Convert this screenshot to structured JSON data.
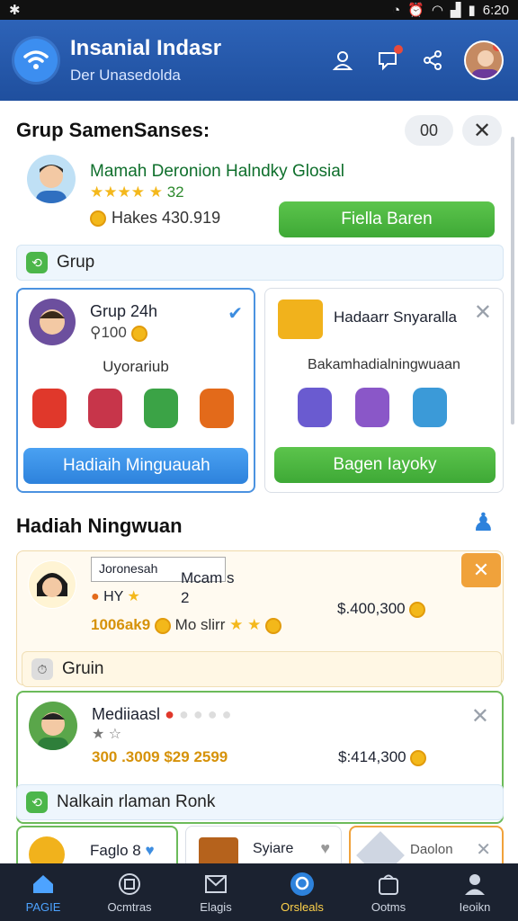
{
  "status": {
    "time": "6:20"
  },
  "appbar": {
    "title": "Insanial Indasr",
    "subtitle": "Der Unasedolda"
  },
  "section1": {
    "title": "Grup SamenSanses:",
    "pill_value": "00",
    "profile": {
      "name": "Mamah Deronion Halndky Glosial",
      "rating": "32",
      "coins_label": "Hakes 430.919",
      "button": "Fiella Baren"
    }
  },
  "grup_strip": {
    "label": "Grup"
  },
  "card_left": {
    "title": "Grup 24h",
    "points": "100",
    "subtitle": "Uyorariub",
    "icons": [
      "Alsate",
      "Ploine",
      "Sendin",
      "Jarraelu"
    ],
    "button": "Hadiaih Minguauah"
  },
  "card_right": {
    "title": "Hadaarr Snyaralla",
    "subtitle": "Bakamhadialningwuaan",
    "icons": [
      "Rousle",
      "Serofe",
      "Alesd"
    ],
    "button": "Bagen Iayoky"
  },
  "section2": {
    "title": "Hadiah Ningwuan"
  },
  "entry1": {
    "tag": "Joronesah",
    "name": "Mcam s",
    "num": "2",
    "sub": "HY",
    "amount_left": "1006ak9",
    "amount_left2": "Mo slirr",
    "amount_right": "$.400,300"
  },
  "strip2": {
    "label": "Gruin"
  },
  "entry2": {
    "name": "Mediiaasl",
    "amount_left": "300 .3009 $29 2599",
    "amount_right": "$:414,300"
  },
  "strip3": {
    "label": "Nalkain rlaman Ronk"
  },
  "mini": {
    "a": "Faglo 8",
    "b": "Syiare",
    "c": "Daolon"
  },
  "nav": [
    "PAGIE",
    "Ocmtras",
    "Elagis",
    "Orsleals",
    "Ootms",
    "Ieoikn"
  ]
}
